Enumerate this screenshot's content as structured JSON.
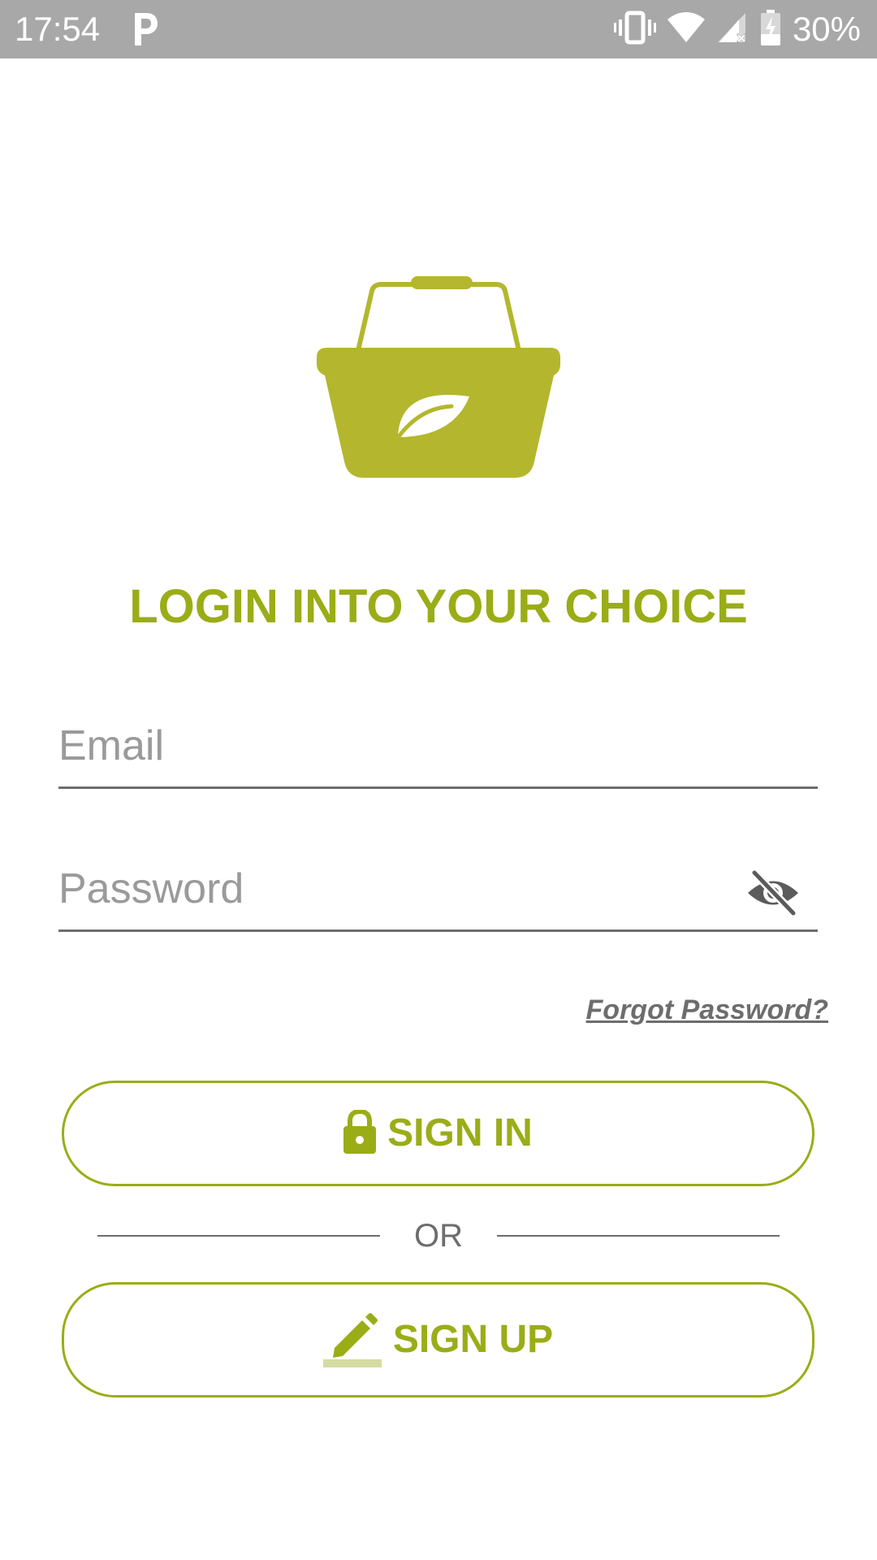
{
  "status_bar": {
    "time": "17:54",
    "battery": "30%",
    "icons": [
      "parking-icon",
      "vibrate-icon",
      "wifi-icon",
      "cell-signal-icon",
      "battery-charging-icon"
    ]
  },
  "logo": {
    "icon": "basket-leaf-icon",
    "color": "#b4b72d"
  },
  "title": "LOGIN INTO YOUR CHOICE",
  "email": {
    "placeholder": "Email",
    "value": ""
  },
  "password": {
    "placeholder": "Password",
    "value": "",
    "toggle_icon": "eye-off-icon"
  },
  "forgot_password": "Forgot Password?",
  "sign_in": {
    "label": "SIGN IN",
    "icon": "lock-icon"
  },
  "divider": {
    "label": "OR"
  },
  "sign_up": {
    "label": "SIGN UP",
    "icon": "pencil-icon"
  },
  "colors": {
    "accent": "#9aad17",
    "status_bar": "#a8a8a8",
    "muted": "#6d6d6d"
  }
}
